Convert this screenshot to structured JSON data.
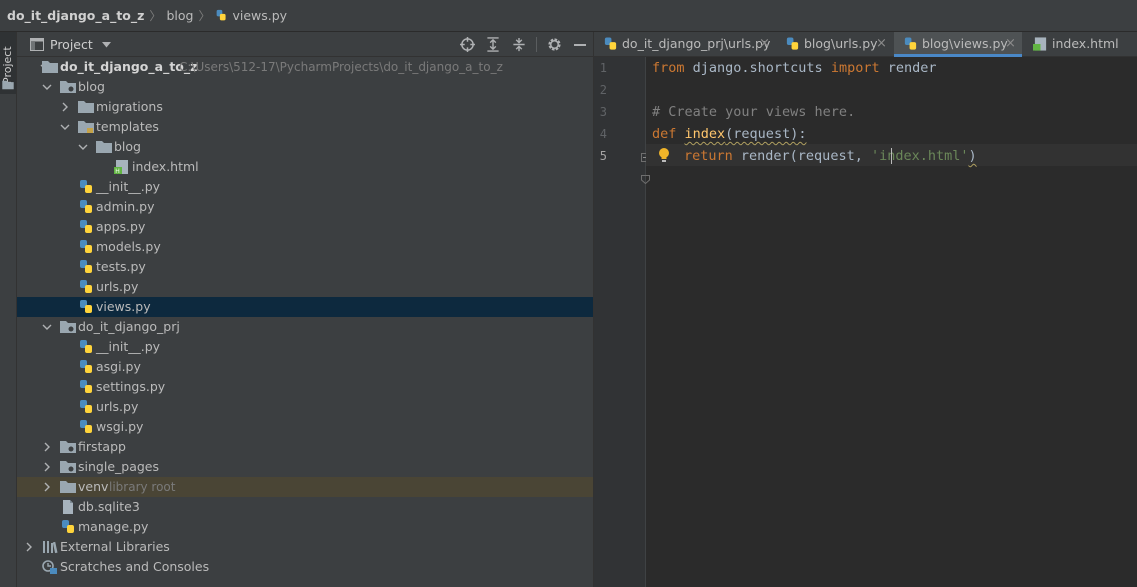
{
  "breadcrumb": {
    "project": "do_it_django_a_to_z",
    "folder": "blog",
    "file": "views.py"
  },
  "tool_window_stripe": {
    "label": "Project"
  },
  "project_panel": {
    "title": "Project",
    "header_icons": [
      "locate-icon",
      "expand-all-icon",
      "collapse-all-icon",
      "gear-icon",
      "hide-icon"
    ]
  },
  "tree": {
    "root": {
      "name": "do_it_django_a_to_z",
      "path": "C:\\Users\\512-17\\PycharmProjects\\do_it_django_a_to_z"
    },
    "blog": "blog",
    "migrations": "migrations",
    "templates": "templates",
    "templates_blog": "blog",
    "index_html": "index.html",
    "blog_files": [
      "__init__.py",
      "admin.py",
      "apps.py",
      "models.py",
      "tests.py",
      "urls.py",
      "views.py"
    ],
    "prj": "do_it_django_prj",
    "prj_files": [
      "__init__.py",
      "asgi.py",
      "settings.py",
      "urls.py",
      "wsgi.py"
    ],
    "firstapp": "firstapp",
    "single_pages": "single_pages",
    "venv": {
      "name": "venv",
      "hint": "library root"
    },
    "db": "db.sqlite3",
    "manage": "manage.py",
    "external_libraries": "External Libraries",
    "scratches": "Scratches and Consoles"
  },
  "editor": {
    "tabs": [
      {
        "label": "do_it_django_prj\\urls.py",
        "active": false
      },
      {
        "label": "blog\\urls.py",
        "active": false
      },
      {
        "label": "blog\\views.py",
        "active": true
      },
      {
        "label": "index.html",
        "active": false
      }
    ],
    "close_glyph": "×",
    "line_numbers": [
      "1",
      "2",
      "3",
      "4",
      "5"
    ],
    "code": {
      "l1_from": "from",
      "l1_module": " django.shortcuts ",
      "l1_import": "import",
      "l1_name": " render",
      "l3_comment": "# Create your views here.",
      "l4_def": "def",
      "l4_name": "index",
      "l4_rest": "(request):",
      "l5_return": "return",
      "l5_call": " render(request, ",
      "l5_string": "'index.html'",
      "l5_close": ")"
    }
  },
  "colors": {
    "background": "#2b2b2b",
    "panel": "#3c3f41",
    "selection": "#0d293e",
    "keyword": "#cc7832",
    "function": "#ffc66d",
    "string": "#6a8759",
    "comment": "#808080",
    "python_blue": "#4b8bbe",
    "python_yellow": "#ffd43b",
    "folder": "#9aa7b0",
    "tab_underline": "#4a88c7"
  }
}
